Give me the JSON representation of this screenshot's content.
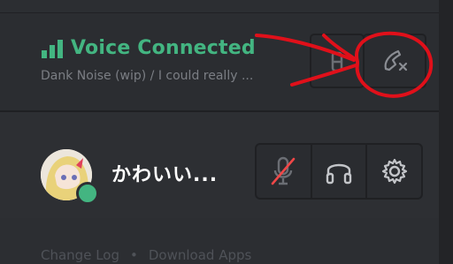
{
  "voice": {
    "status": "Voice Connected",
    "channel": "Dank Noise (wip) / I could really ..."
  },
  "user": {
    "name": "かわいい..."
  },
  "footer": {
    "links": [
      "Change Log",
      "Download Apps"
    ],
    "separator": "•"
  },
  "icons": {
    "signal": "signal-bars-icon",
    "screen_share": "screen-share-icon",
    "disconnect": "phone-disconnect-icon",
    "mute": "microphone-muted-icon",
    "deafen": "headphones-icon",
    "settings": "gear-icon"
  },
  "colors": {
    "connected": "#43b581",
    "annotation": "#e0101a",
    "mute_slash": "#f04747"
  }
}
